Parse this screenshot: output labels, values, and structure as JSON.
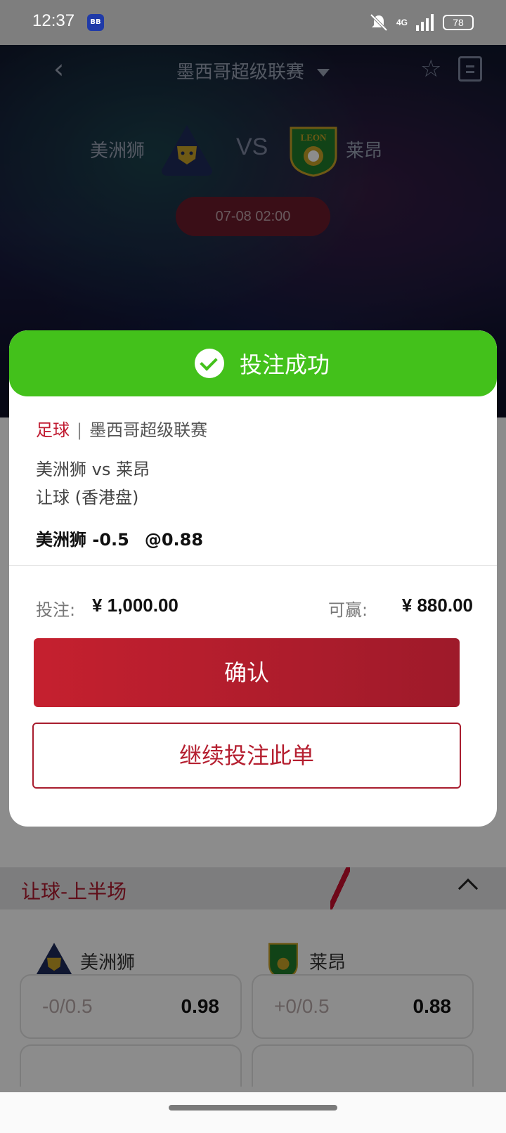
{
  "status_bar": {
    "time": "12:37",
    "app_badge": "BB",
    "network": "4G",
    "battery": "78"
  },
  "header": {
    "back_glyph": "‹",
    "league": "墨西哥超级联赛"
  },
  "match": {
    "home_team": "美洲狮",
    "away_team": "莱昂",
    "vs": "VS",
    "kickoff": "07-08 02:00",
    "away_logo_text": "LEON"
  },
  "modal": {
    "title": "投注成功",
    "sport": "足球",
    "separator": "|",
    "league": "墨西哥超级联赛",
    "match_line": "美洲狮 vs 莱昂",
    "market": "让球 (香港盘)",
    "selection": "美洲狮 -0.5",
    "selection_odds": "@0.88",
    "stake_label": "投注:",
    "stake_value": "¥ 1,000.00",
    "win_label": "可赢:",
    "win_value": "¥ 880.00",
    "confirm_label": "确认",
    "continue_label": "继续投注此单"
  },
  "section": {
    "title": "让球-上半场",
    "home_team": "美洲狮",
    "away_team": "莱昂",
    "rows": [
      {
        "home_hcap": "-0/0.5",
        "home_odd": "0.98",
        "away_hcap": "+0/0.5",
        "away_odd": "0.88"
      }
    ]
  },
  "colors": {
    "success": "#43c11b",
    "brand_red": "#c01a30"
  }
}
